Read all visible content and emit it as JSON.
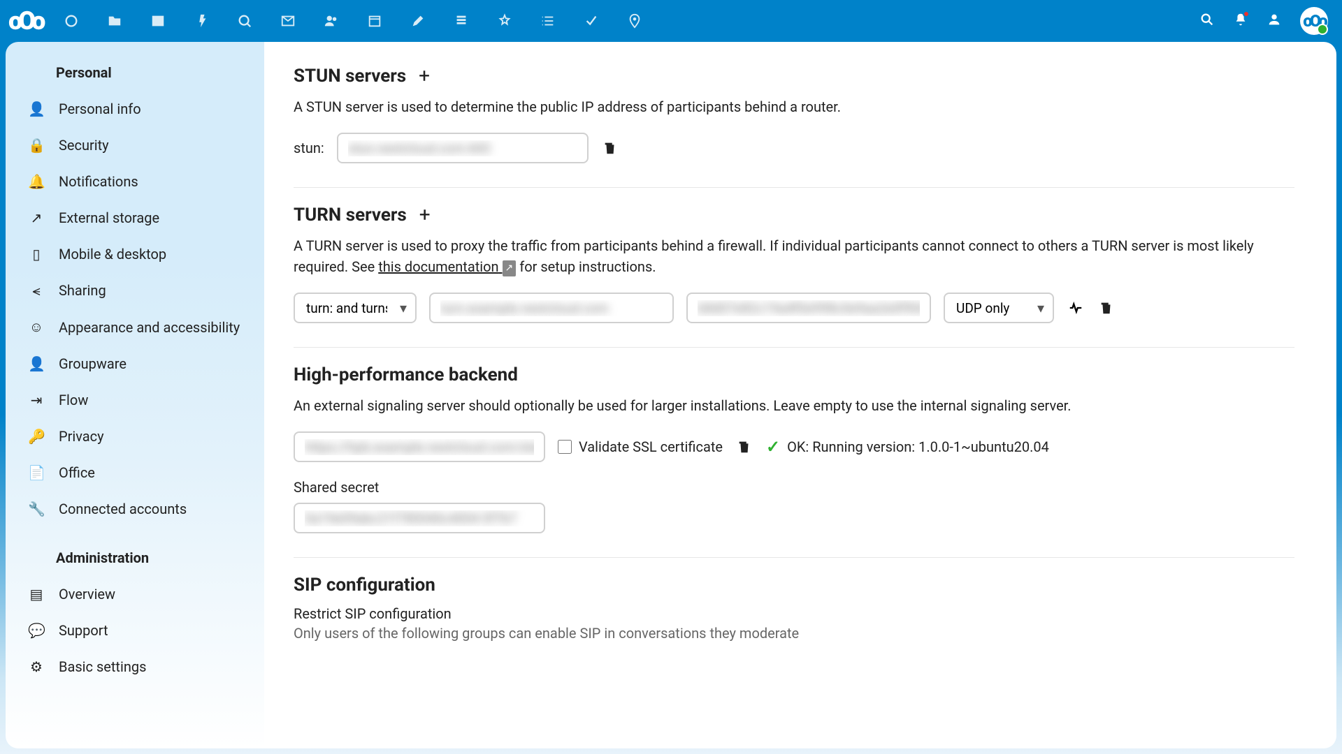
{
  "sidebar": {
    "personal_header": "Personal",
    "admin_header": "Administration",
    "items_personal": [
      {
        "label": "Personal info"
      },
      {
        "label": "Security"
      },
      {
        "label": "Notifications"
      },
      {
        "label": "External storage"
      },
      {
        "label": "Mobile & desktop"
      },
      {
        "label": "Sharing"
      },
      {
        "label": "Appearance and accessibility"
      },
      {
        "label": "Groupware"
      },
      {
        "label": "Flow"
      },
      {
        "label": "Privacy"
      },
      {
        "label": "Office"
      },
      {
        "label": "Connected accounts"
      }
    ],
    "items_admin": [
      {
        "label": "Overview"
      },
      {
        "label": "Support"
      },
      {
        "label": "Basic settings"
      }
    ]
  },
  "stun": {
    "title": "STUN servers",
    "desc": "A STUN server is used to determine the public IP address of participants behind a router.",
    "prefix": "stun:",
    "value": "stun.nextcloud.com:443"
  },
  "turn": {
    "title": "TURN servers",
    "desc_pre": "A TURN server is used to proxy the traffic from participants behind a firewall. If individual participants cannot connect to others a TURN server is most likely required. See ",
    "link": "this documentation",
    "desc_post": " for setup instructions.",
    "scheme": "turn: and turns:",
    "server": "turn.example.nextcloud.com",
    "secret": "b8d07e82c19a4f0e998c0e9aa2e0f904",
    "protocol": "UDP only"
  },
  "hpb": {
    "title": "High-performance backend",
    "desc": "An external signaling server should optionally be used for larger installations. Leave empty to use the internal signaling server.",
    "url": "https://hpb.example.nextcloud.com/standalone",
    "validate_label": "Validate SSL certificate",
    "status": "OK: Running version: 1.0.0-1~ubuntu20.04",
    "secret_label": "Shared secret",
    "secret": "0a19e09abc21f780040c4004 0f7b7"
  },
  "sip": {
    "title": "SIP configuration",
    "restrict_label": "Restrict SIP configuration",
    "restrict_desc": "Only users of the following groups can enable SIP in conversations they moderate"
  }
}
